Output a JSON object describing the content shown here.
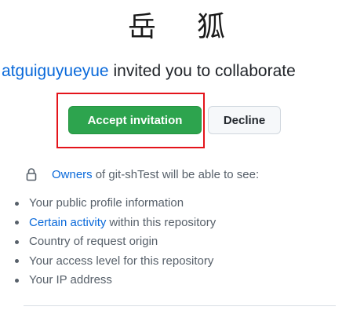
{
  "org": {
    "logo_text_left": "岳",
    "logo_text_right": "狐"
  },
  "invite": {
    "username": "atguiguyueyue",
    "message": "invited you to collaborate"
  },
  "actions": {
    "accept_label": "Accept invitation",
    "decline_label": "Decline"
  },
  "visibility": {
    "owners_link": "Owners",
    "text": "of git-shTest will be able to see:"
  },
  "permissions": [
    {
      "link": "",
      "text": "Your public profile information"
    },
    {
      "link": "Certain activity",
      "text": "within this repository"
    },
    {
      "link": "",
      "text": "Country of request origin"
    },
    {
      "link": "",
      "text": "Your access level for this repository"
    },
    {
      "link": "",
      "text": "Your IP address"
    }
  ],
  "colors": {
    "accent_link": "#0969da",
    "accept_button": "#2da44e",
    "highlight_border": "#e4141b",
    "muted_text": "#57606a"
  },
  "icons": {
    "visibility": "lock-icon"
  }
}
